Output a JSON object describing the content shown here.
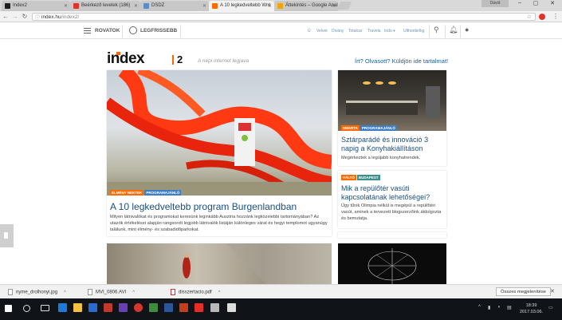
{
  "browser": {
    "tabs": [
      {
        "label": "Index2",
        "active": false
      },
      {
        "label": "Beérkező levelek (186)",
        "active": false
      },
      {
        "label": "DSDZ",
        "active": false
      },
      {
        "label": "A 10 legkedveltebb Wnt",
        "active": true
      },
      {
        "label": "Áttekintés – Google Anal",
        "active": false
      }
    ],
    "user_badge": "Dávid",
    "url_domain": "index.hu",
    "url_path": "/index2/",
    "accent": "#e4312b"
  },
  "site_nav": {
    "rovatok": "ROVATOK",
    "legfrissebb": "LEGFRISSEBB",
    "sections": [
      "Ü",
      "Velvet",
      "Divány",
      "Totalcar",
      "Travela",
      "Indo ▾",
      "Ulthonbirlkg"
    ]
  },
  "page": {
    "logo_text": "index",
    "logo_num": "2",
    "tagline": "A népi internet legjava",
    "cta": "Írt? Olvasott? Küldjön ide tartalmat!"
  },
  "articles": {
    "main": {
      "tags": [
        "ÉLMÉNY NEKTEK",
        "PROGRAMAJÁNLÓ"
      ],
      "title": "A 10 legkedveltebb program Burgenlandban",
      "lead": "Milyen látnivalókat és programokat keresünk leginkább Ausztria hozzánk legközelebbi tartományában? Az utazók értékelései alapján rangsorolt legjobb látnivalók listáján különleges várat és hegyi templomot ugyanúgy találunk, mint élmény- és szabadidőparkokat."
    },
    "side1": {
      "tags": [
        "SMARTA",
        "PROGRAMAJÁNLÓ"
      ],
      "title": "Sztárparádé és innováció 3 napig a Konyhakiállításon",
      "lead": "Megérkeztek a legújabb konyhatrendek."
    },
    "side2": {
      "tags": [
        "VÁLTÓ",
        "BUDAPEST"
      ],
      "title": "Mik a repülőtér vasúti kapcsolatának lehetőségei?",
      "lead": "Úgy tűnik Olimpia nélkül is megépül a repülőtéri vasút, aminek a tervezett blogszerzőink átdolgozta és bemutatja."
    }
  },
  "downloads": {
    "items": [
      "nyme_drolhonyi.jpg",
      "MVI_0806.AVI",
      "disszertacio.pdf"
    ],
    "show_all": "Összes megjelenítése"
  },
  "taskbar": {
    "time": "18:39",
    "date": "2017.03.06."
  }
}
